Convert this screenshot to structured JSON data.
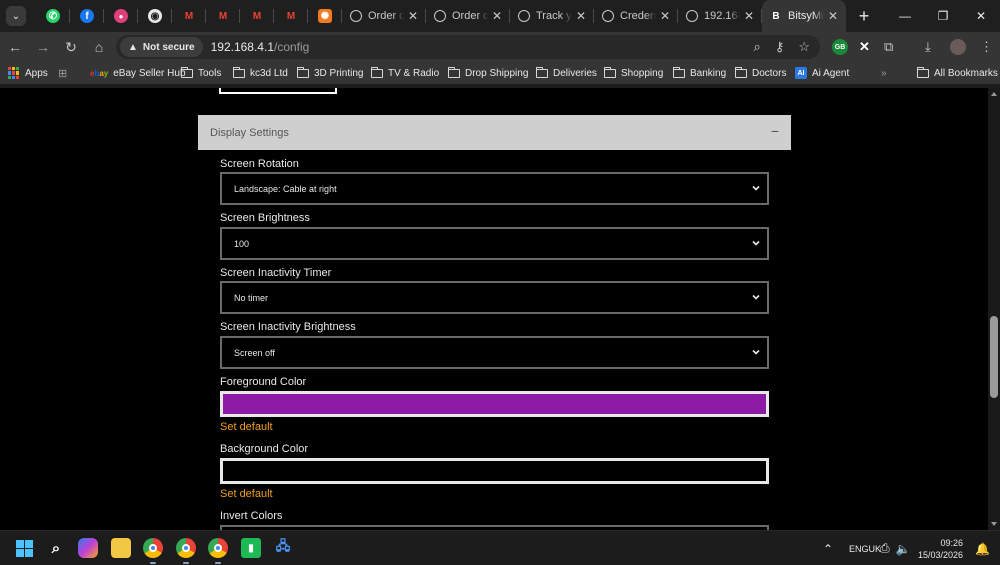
{
  "browser": {
    "tabs": [
      {
        "title": "Order de",
        "active": false
      },
      {
        "title": "Order de",
        "active": false
      },
      {
        "title": "Track yo",
        "active": false
      },
      {
        "title": "Credent",
        "active": false
      },
      {
        "title": "192.168.",
        "active": false
      },
      {
        "title": "BitsyMin",
        "active": true
      }
    ],
    "pinned_icons": [
      "whatsapp-icon",
      "facebook-icon",
      "app-icon",
      "github-icon",
      "gmail-icon",
      "gmail-icon",
      "gmail-icon",
      "gmail-icon",
      "grafana-icon"
    ],
    "address": {
      "security_label": "Not secure",
      "host": "192.168.4.1",
      "path": "/config"
    },
    "profile_badge": "GB",
    "bookmarks": [
      {
        "label": "Apps",
        "icon": "apps-grid-icon"
      },
      {
        "label": "eBay Seller Hub",
        "icon": "ebay-icon"
      },
      {
        "label": "Tools",
        "icon": "folder-icon"
      },
      {
        "label": "kc3d Ltd",
        "icon": "folder-icon"
      },
      {
        "label": "3D Printing",
        "icon": "folder-icon"
      },
      {
        "label": "TV & Radio",
        "icon": "folder-icon"
      },
      {
        "label": "Drop Shipping",
        "icon": "folder-icon"
      },
      {
        "label": "Deliveries",
        "icon": "folder-icon"
      },
      {
        "label": "Shopping",
        "icon": "folder-icon"
      },
      {
        "label": "Banking",
        "icon": "folder-icon"
      },
      {
        "label": "Doctors",
        "icon": "folder-icon"
      },
      {
        "label": "Ai Agent",
        "icon": "ai-icon"
      }
    ],
    "all_bookmarks": "All Bookmarks"
  },
  "page": {
    "section_title": "Display Settings",
    "fields": {
      "rotation": {
        "label": "Screen Rotation",
        "value": "Landscape: Cable at right"
      },
      "brightness": {
        "label": "Screen Brightness",
        "value": "100"
      },
      "inactivity_timer": {
        "label": "Screen Inactivity Timer",
        "value": "No timer"
      },
      "inactivity_brightness": {
        "label": "Screen Inactivity Brightness",
        "value": "Screen off"
      },
      "foreground": {
        "label": "Foreground Color",
        "color": "#8e1aa8",
        "default_link": "Set default"
      },
      "background": {
        "label": "Background Color",
        "color": "#000000",
        "default_link": "Set default"
      },
      "invert": {
        "label": "Invert Colors"
      }
    }
  },
  "taskbar": {
    "language": "ENG",
    "region": "UK",
    "time": "09:26",
    "date": "15/03/2026"
  },
  "colors": {
    "accent_link": "#f0a020",
    "header_bg": "#cfcfcf"
  }
}
